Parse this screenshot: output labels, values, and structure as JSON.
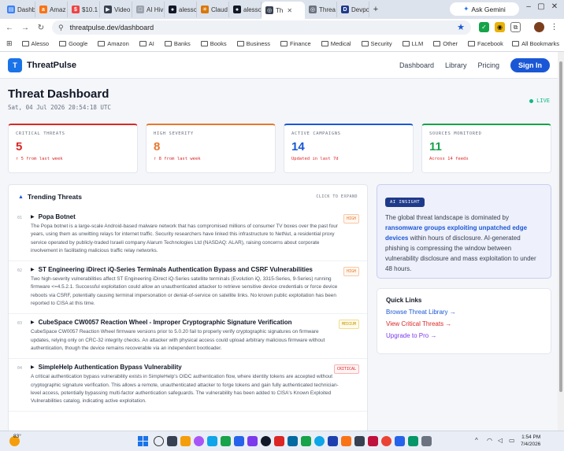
{
  "browser": {
    "tabs": [
      {
        "label": "Dashb",
        "color": "#3b82f6",
        "glyph": "▤"
      },
      {
        "label": "Amaz",
        "color": "#f97316",
        "glyph": "a"
      },
      {
        "label": "$10.1",
        "color": "#ef4444",
        "glyph": "$"
      },
      {
        "label": "Video",
        "color": "#374151",
        "glyph": "▶"
      },
      {
        "label": "AI Hiv",
        "color": "#9ca3af",
        "glyph": "□"
      },
      {
        "label": "alesso",
        "color": "#111827",
        "glyph": "●"
      },
      {
        "label": "Claud",
        "color": "#d97706",
        "glyph": "✳"
      },
      {
        "label": "alesso",
        "color": "#111827",
        "glyph": "●"
      },
      {
        "label": "Th",
        "color": "#374151",
        "glyph": "◎"
      },
      {
        "label": "Threa",
        "color": "#6b7280",
        "glyph": "◎"
      },
      {
        "label": "Devpo",
        "color": "#1e3a8a",
        "glyph": "D"
      }
    ],
    "active_tab_index": 8,
    "gemini_label": "Ask Gemini",
    "url": "threatpulse.dev/dashboard",
    "bookmarks": [
      "Alesso",
      "Google",
      "Amazon",
      "AI",
      "Banks",
      "Books",
      "Business",
      "Finance",
      "Medical",
      "Security",
      "LLM",
      "Other",
      "Facebook"
    ],
    "all_bookmarks_label": "All Bookmarks"
  },
  "site": {
    "logo_letter": "T",
    "brand": "ThreatPulse",
    "nav": [
      "Dashboard",
      "Library",
      "Pricing"
    ],
    "signin_label": "Sign In"
  },
  "dashboard": {
    "title": "Threat Dashboard",
    "timestamp": "Sat, 04 Jul 2026 20:54:18 UTC",
    "live_label": "LIVE",
    "stats": [
      {
        "label": "CRITICAL THREATS",
        "value": "5",
        "sub": "↑ 5 from last week",
        "color": "#dc2626",
        "sub_color": "#dc2626"
      },
      {
        "label": "HIGH SEVERITY",
        "value": "8",
        "sub": "↑ 8 from last week",
        "color": "#e8772e",
        "sub_color": "#dc2626"
      },
      {
        "label": "ACTIVE CAMPAIGNS",
        "value": "14",
        "sub": "Updated in last 7d",
        "color": "#1a57d6",
        "sub_color": "#dc2626"
      },
      {
        "label": "SOURCES MONITORED",
        "value": "11",
        "sub": "Across 14 feeds",
        "color": "#16a34a",
        "sub_color": "#dc2626"
      }
    ]
  },
  "trending": {
    "title": "Trending Threats",
    "expand_hint": "CLICK TO EXPAND",
    "items": [
      {
        "num": "01",
        "name": "Popa Botnet",
        "severity": "HIGH",
        "sev_class": "high",
        "desc": "The Popa botnet is a large-scale Android-based malware network that has compromised millions of consumer TV boxes over the past four years, using them as unwitting relays for internet traffic. Security researchers have linked this infrastructure to NetNut, a residential proxy service operated by publicly-traded Israeli company Alarum Technologies Ltd (NASDAQ: ALAR), raising concerns about corporate involvement in facilitating malicious traffic relay networks."
      },
      {
        "num": "02",
        "name": "ST Engineering iDirect iQ-Series Terminals Authentication Bypass and CSRF Vulnerabilities",
        "severity": "HIGH",
        "sev_class": "high",
        "desc": "Two high-severity vulnerabilities affect ST Engineering iDirect iQ-Series satellite terminals (Evolution iQ, 3315-Series, 9-Series) running firmware <=4.5.2.1. Successful exploitation could allow an unauthenticated attacker to retrieve sensitive device credentials or force device reboots via CSRF, potentially causing terminal impersonation or denial-of-service on satellite links. No known public exploitation has been reported to CISA at this time."
      },
      {
        "num": "03",
        "name": "CubeSpace CW0057 Reaction Wheel - Improper Cryptographic Signature Verification",
        "severity": "MEDIUM",
        "sev_class": "medium",
        "desc": "CubeSpace CW0057 Reaction Wheel firmware versions prior to 5.0.20 fail to properly verify cryptographic signatures on firmware updates, relying only on CRC-32 integrity checks. An attacker with physical access could upload arbitrary malicious firmware without authentication, though the device remains recoverable via an independent bootloader."
      },
      {
        "num": "04",
        "name": "SimpleHelp Authentication Bypass Vulnerability",
        "severity": "CRITICAL",
        "sev_class": "critical",
        "desc": "A critical authentication bypass vulnerability exists in SimpleHelp's OIDC authentication flow, where identity tokens are accepted without cryptographic signature verification. This allows a remote, unauthenticated attacker to forge tokens and gain fully authenticated technician-level access, potentially bypassing multi-factor authentication safeguards. The vulnerability has been added to CISA's Known Exploited Vulnerabilities catalog, indicating active exploitation."
      }
    ]
  },
  "insight": {
    "badge": "AI INSIGHT",
    "text_before": "The global threat landscape is dominated by ",
    "text_highlight": "ransomware groups exploiting unpatched edge devices",
    "text_after": " within hours of disclosure. AI-generated phishing is compressing the window between vulnerability disclosure and mass exploitation to under 48 hours."
  },
  "quick_links": {
    "title": "Quick Links",
    "links": [
      {
        "label": "Browse Threat Library →",
        "color": "#1a57d6"
      },
      {
        "label": "View Critical Threats →",
        "color": "#dc2626"
      },
      {
        "label": "Upgrade to Pro →",
        "color": "#7c3aed"
      }
    ]
  },
  "taskbar": {
    "temperature": "83°",
    "time": "1:54 PM",
    "date": "7/4/2026"
  }
}
